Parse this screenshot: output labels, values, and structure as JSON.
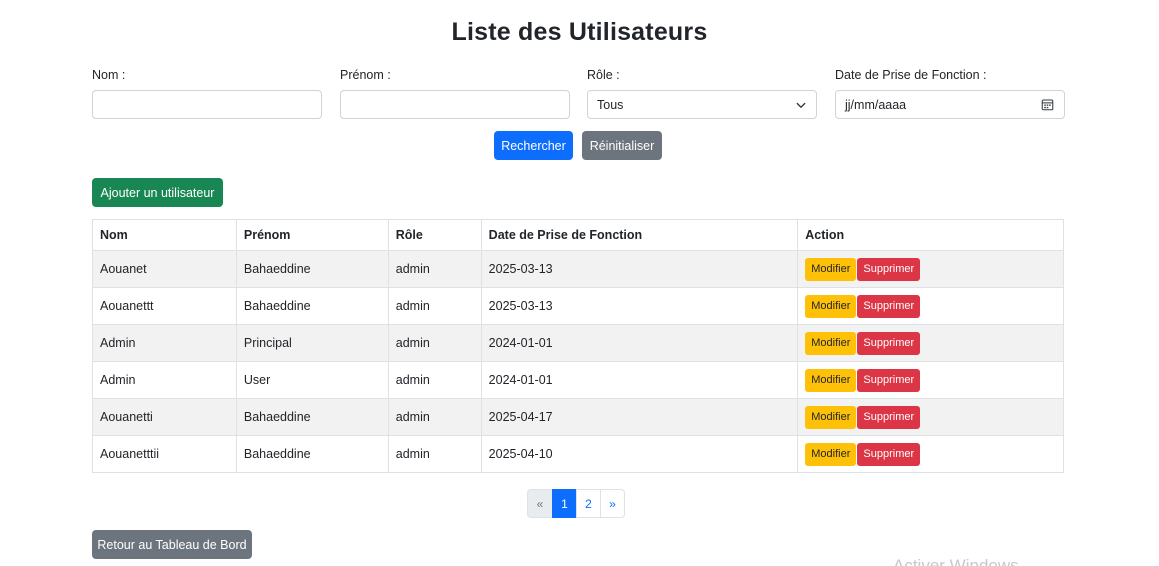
{
  "page": {
    "title": "Liste des Utilisateurs"
  },
  "filters": {
    "nom": {
      "label": "Nom :",
      "value": ""
    },
    "prenom": {
      "label": "Prénom :",
      "value": ""
    },
    "role": {
      "label": "Rôle :",
      "value": "Tous"
    },
    "date": {
      "label": "Date de Prise de Fonction :",
      "placeholder": "jj/mm/aaaa"
    }
  },
  "actions": {
    "search": "Rechercher",
    "reset": "Réinitialiser",
    "add_user": "Ajouter un utilisateur",
    "back": "Retour au Tableau de Bord"
  },
  "table": {
    "headers": [
      "Nom",
      "Prénom",
      "Rôle",
      "Date de Prise de Fonction",
      "Action"
    ],
    "edit_label": "Modifier",
    "delete_label": "Supprimer",
    "rows": [
      [
        "Aouanet",
        "Bahaeddine",
        "admin",
        "2025-03-13"
      ],
      [
        "Aouanettt",
        "Bahaeddine",
        "admin",
        "2025-03-13"
      ],
      [
        "Admin",
        "Principal",
        "admin",
        "2024-01-01"
      ],
      [
        "Admin",
        "User",
        "admin",
        "2024-01-01"
      ],
      [
        "Aouanetti",
        "Bahaeddine",
        "admin",
        "2025-04-17"
      ],
      [
        "Aouanetttii",
        "Bahaeddine",
        "admin",
        "2025-04-10"
      ]
    ]
  },
  "pagination": {
    "prev": "«",
    "pages": [
      "1",
      "2"
    ],
    "current": "1",
    "next": "»"
  },
  "colors": {
    "primary": "#0d6efd",
    "secondary": "#6c757d",
    "success": "#198754",
    "warning": "#ffc107",
    "danger": "#dc3545"
  },
  "watermark": "Activer Windows"
}
